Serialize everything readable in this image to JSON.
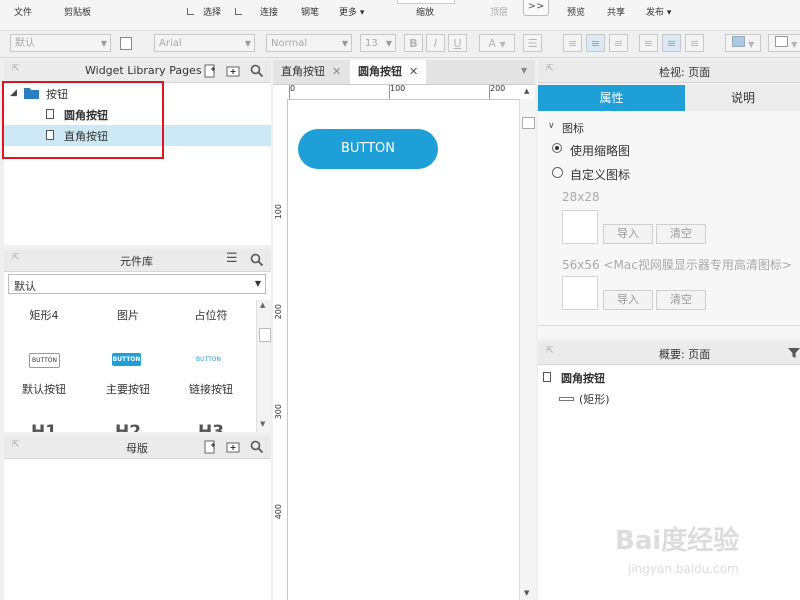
{
  "toolbar": {
    "items": [
      "文件",
      "剪贴板",
      "选择",
      "连接",
      "钢笔",
      "更多 ▾",
      "缩放",
      "顶层",
      "预览",
      "共享",
      "发布 ▾"
    ]
  },
  "format_bar": {
    "style_select": "默认",
    "font_select": "Arial",
    "weight_select": "Normal",
    "size_select": "13",
    "bold": "B",
    "italic": "I",
    "underline": "U",
    "text_color": "A"
  },
  "pages_panel": {
    "title": "Widget Library Pages",
    "folder": "按钮",
    "pages": [
      "圆角按钮",
      "直角按钮"
    ]
  },
  "library_panel": {
    "title": "元件库",
    "select": "默认",
    "row1": [
      "矩形4",
      "图片",
      "占位符"
    ],
    "row2_thumbs": [
      "BUTTON",
      "BUTTON",
      "BUTTON"
    ],
    "row2": [
      "默认按钮",
      "主要按钮",
      "链接按钮"
    ],
    "row3": [
      "H1",
      "H2",
      "H3"
    ]
  },
  "master_panel": {
    "title": "母版"
  },
  "canvas": {
    "tabs": [
      "直角按钮",
      "圆角按钮"
    ],
    "ruler_h": [
      "0",
      "100",
      "200"
    ],
    "ruler_v": [
      "100",
      "200",
      "300",
      "400"
    ],
    "button_label": "BUTTON"
  },
  "inspector": {
    "title": "检视: 页面",
    "tab_props": "属性",
    "tab_notes": "说明",
    "section": "图标",
    "opt1": "使用缩略图",
    "opt2": "自定义图标",
    "size1": "28x28",
    "size2": "56x56 <Mac视网膜显示器专用高清图标>",
    "import": "导入",
    "clear": "清空"
  },
  "outline": {
    "title": "概要: 页面",
    "page": "圆角按钮",
    "child": "(矩形)"
  },
  "watermark": {
    "logo": "Bai度经验",
    "url": "jingyan.baidu.com"
  },
  "colors": {
    "accent": "#1e9fd8",
    "selection": "#cde8f5",
    "highlight_box": "#e0141e"
  }
}
